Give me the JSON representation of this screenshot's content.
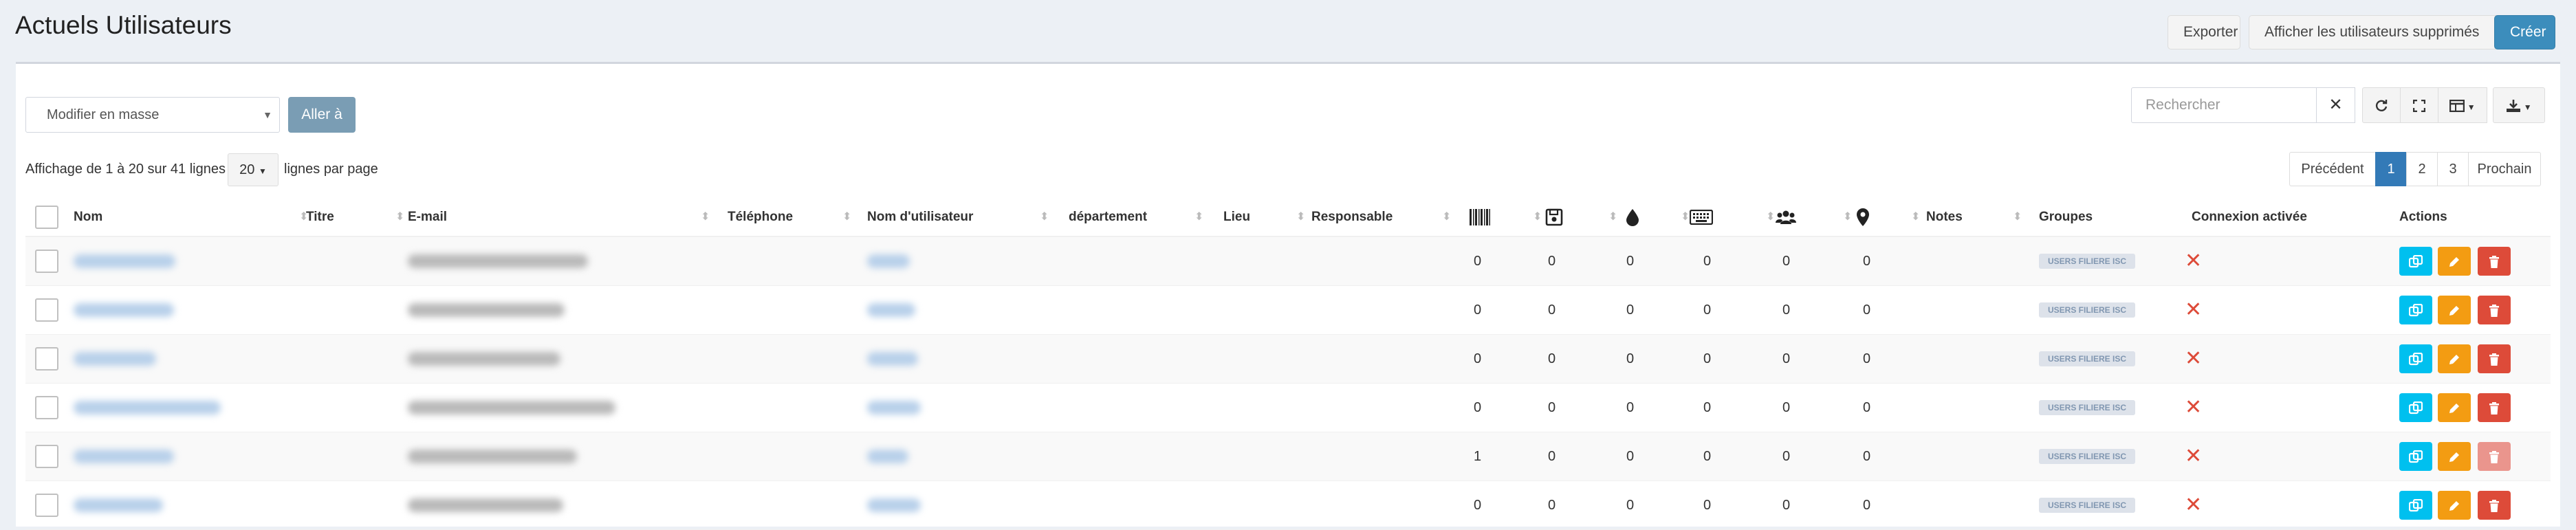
{
  "header": {
    "title": "Actuels Utilisateurs",
    "export_label": "Exporter",
    "show_deleted_label": "Afficher les utilisateurs supprimés",
    "create_label": "Créer"
  },
  "toolbar": {
    "bulk_select_value": "Modifier en masse",
    "go_label": "Aller à",
    "search_placeholder": "Rechercher",
    "icons": [
      "refresh-icon",
      "fullscreen-icon",
      "columns-icon",
      "download-icon"
    ]
  },
  "info": {
    "showing": "Affichage de 1 à 20 sur 41 lignes",
    "page_size": "20",
    "per_page": "lignes par page"
  },
  "pagination": {
    "prev": "Précédent",
    "pages": [
      "1",
      "2",
      "3"
    ],
    "active_page": "1",
    "next": "Prochain"
  },
  "columns": {
    "name": "Nom",
    "title": "Titre",
    "email": "E-mail",
    "phone": "Téléphone",
    "username": "Nom d'utilisateur",
    "department": "département",
    "location": "Lieu",
    "manager": "Responsable",
    "icon_columns": [
      "barcode-icon",
      "floppy-disk-icon",
      "drop-icon",
      "keyboard-icon",
      "users-icon",
      "map-marker-icon"
    ],
    "notes": "Notes",
    "groups": "Groupes",
    "login_enabled": "Connexion activée",
    "actions": "Actions"
  },
  "rows": [
    {
      "counts": [
        "0",
        "0",
        "0",
        "0",
        "0",
        "0"
      ],
      "group": "USERS FILIERE ISC",
      "delete_enabled": true
    },
    {
      "counts": [
        "0",
        "0",
        "0",
        "0",
        "0",
        "0"
      ],
      "group": "USERS FILIERE ISC",
      "delete_enabled": true
    },
    {
      "counts": [
        "0",
        "0",
        "0",
        "0",
        "0",
        "0"
      ],
      "group": "USERS FILIERE ISC",
      "delete_enabled": true
    },
    {
      "counts": [
        "0",
        "0",
        "0",
        "0",
        "0",
        "0"
      ],
      "group": "USERS FILIERE ISC",
      "delete_enabled": true
    },
    {
      "counts": [
        "1",
        "0",
        "0",
        "0",
        "0",
        "0"
      ],
      "group": "USERS FILIERE ISC",
      "delete_enabled": false
    },
    {
      "counts": [
        "0",
        "0",
        "0",
        "0",
        "0",
        "0"
      ],
      "group": "USERS FILIERE ISC",
      "delete_enabled": true
    }
  ],
  "colors": {
    "primary": "#3c8dbc",
    "clone": "#00c0ef",
    "edit": "#f39c12",
    "delete": "#dd4b39",
    "login_disabled": "#dd4b39"
  }
}
